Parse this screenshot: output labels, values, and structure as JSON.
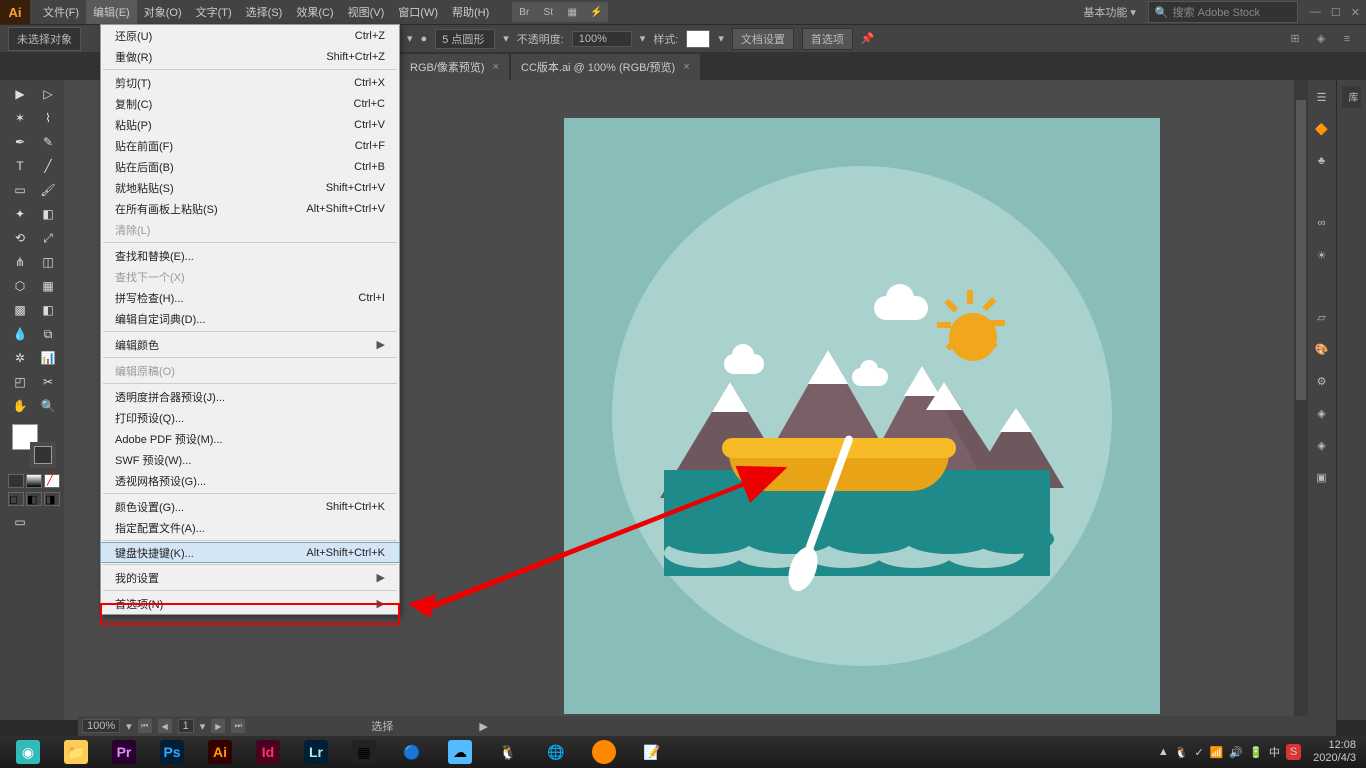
{
  "menubar": {
    "items": [
      "文件(F)",
      "编辑(E)",
      "对象(O)",
      "文字(T)",
      "选择(S)",
      "效果(C)",
      "视图(V)",
      "窗口(W)",
      "帮助(H)"
    ],
    "active_index": 1,
    "bridge": "Br",
    "stock": "St",
    "workspace": "基本功能",
    "search_ph": "搜索 Adobe Stock"
  },
  "options": {
    "noselect": "未选择对象",
    "stroke_val": "",
    "brush": "5 点圆形",
    "opacity_label": "不透明度:",
    "opacity": "100%",
    "style_label": "样式:",
    "doc_setup": "文档设置",
    "prefs": "首选项"
  },
  "tabs": [
    {
      "label": "RGB/像素预览)",
      "close": "×"
    },
    {
      "label": "CC版本.ai @ 100% (RGB/预览)",
      "close": "×"
    }
  ],
  "edit_menu": [
    {
      "label": "还原(U)",
      "sc": "Ctrl+Z"
    },
    {
      "label": "重做(R)",
      "sc": "Shift+Ctrl+Z"
    },
    {
      "sep": true
    },
    {
      "label": "剪切(T)",
      "sc": "Ctrl+X"
    },
    {
      "label": "复制(C)",
      "sc": "Ctrl+C"
    },
    {
      "label": "粘贴(P)",
      "sc": "Ctrl+V"
    },
    {
      "label": "贴在前面(F)",
      "sc": "Ctrl+F"
    },
    {
      "label": "贴在后面(B)",
      "sc": "Ctrl+B"
    },
    {
      "label": "就地粘贴(S)",
      "sc": "Shift+Ctrl+V"
    },
    {
      "label": "在所有画板上粘贴(S)",
      "sc": "Alt+Shift+Ctrl+V"
    },
    {
      "label": "清除(L)",
      "disabled": true
    },
    {
      "sep": true
    },
    {
      "label": "查找和替换(E)..."
    },
    {
      "label": "查找下一个(X)",
      "disabled": true
    },
    {
      "label": "拼写检查(H)...",
      "sc": "Ctrl+I"
    },
    {
      "label": "编辑自定词典(D)..."
    },
    {
      "sep": true
    },
    {
      "label": "编辑颜色",
      "sub": true
    },
    {
      "sep": true
    },
    {
      "label": "编辑原稿(O)",
      "disabled": true
    },
    {
      "sep": true
    },
    {
      "label": "透明度拼合器预设(J)..."
    },
    {
      "label": "打印预设(Q)..."
    },
    {
      "label": "Adobe PDF 预设(M)..."
    },
    {
      "label": "SWF 预设(W)..."
    },
    {
      "label": "透视网格预设(G)..."
    },
    {
      "sep": true
    },
    {
      "label": "颜色设置(G)...",
      "sc": "Shift+Ctrl+K"
    },
    {
      "label": "指定配置文件(A)..."
    },
    {
      "sep": true
    },
    {
      "label": "键盘快捷键(K)...",
      "sc": "Alt+Shift+Ctrl+K",
      "hl": true
    },
    {
      "sep": true
    },
    {
      "label": "我的设置",
      "sub": true
    },
    {
      "sep": true
    },
    {
      "label": "首选项(N)",
      "sub": true
    }
  ],
  "status": {
    "zoom": "100%",
    "artboard": "1",
    "label": "选择"
  },
  "taskbar": {
    "time": "12:08",
    "date": "2020/4/3"
  },
  "right_panel_label": "库"
}
